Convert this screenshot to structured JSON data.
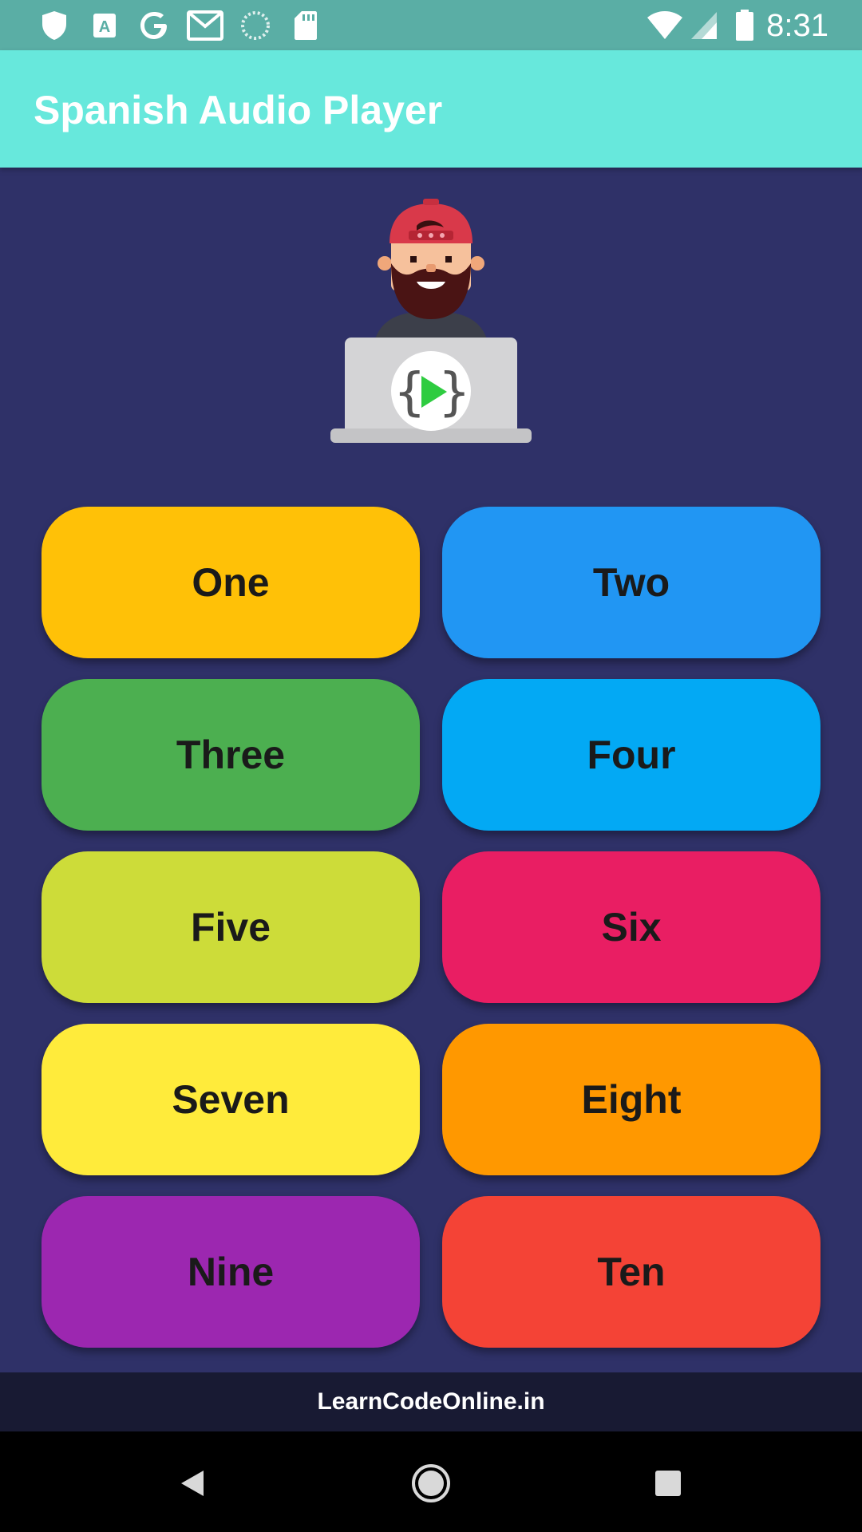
{
  "status_bar": {
    "time": "8:31",
    "icons": [
      "shield-icon",
      "text-icon",
      "google-icon",
      "gmail-icon",
      "sync-icon",
      "sd-card-icon",
      "wifi-icon",
      "signal-icon",
      "battery-icon"
    ]
  },
  "app_bar": {
    "title": "Spanish Audio Player"
  },
  "hero": {
    "image": "developer-with-laptop-logo"
  },
  "buttons": [
    {
      "label": "One",
      "color": "#ffc107"
    },
    {
      "label": "Two",
      "color": "#2196f3"
    },
    {
      "label": "Three",
      "color": "#4caf50"
    },
    {
      "label": "Four",
      "color": "#03a9f4"
    },
    {
      "label": "Five",
      "color": "#cddc39"
    },
    {
      "label": "Six",
      "color": "#e91e63"
    },
    {
      "label": "Seven",
      "color": "#ffeb3b"
    },
    {
      "label": "Eight",
      "color": "#ff9800"
    },
    {
      "label": "Nine",
      "color": "#9c27b0"
    },
    {
      "label": "Ten",
      "color": "#f44336"
    }
  ],
  "footer": {
    "text": "LearnCodeOnline.in"
  },
  "nav_bar": {
    "icons": [
      "back-icon",
      "home-icon",
      "recents-icon"
    ]
  },
  "colors": {
    "background": "#2f3168",
    "app_bar": "#67e8dc",
    "status_bar": "#5aaea5",
    "footer": "#181a33"
  }
}
